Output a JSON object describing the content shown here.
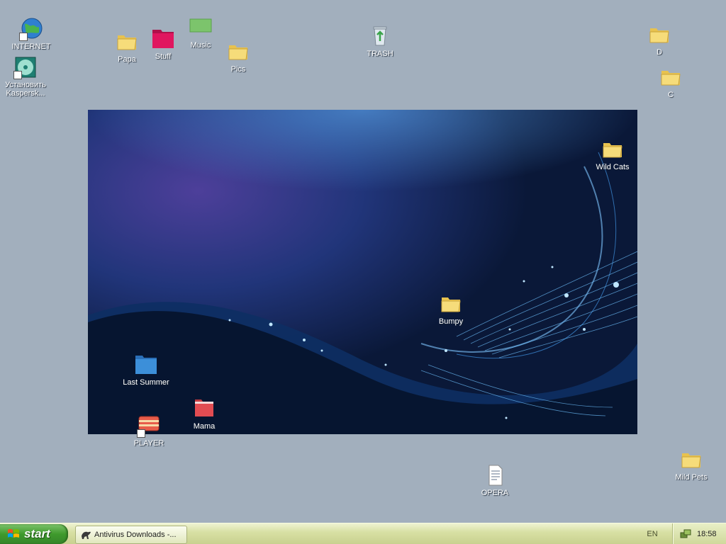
{
  "desktop": {
    "icons": [
      {
        "name": "icon-internet",
        "label": "INTERNET",
        "type": "globe",
        "shortcut": true
      },
      {
        "name": "icon-install-kaspersky",
        "label": "Установить Kaspersk...",
        "type": "cd",
        "shortcut": true
      },
      {
        "name": "icon-papa",
        "label": "Papa",
        "type": "folder"
      },
      {
        "name": "icon-stuff",
        "label": "Stuff",
        "type": "folder-pink"
      },
      {
        "name": "icon-music",
        "label": "Music",
        "type": "folder-green"
      },
      {
        "name": "icon-pics",
        "label": "Pics",
        "type": "folder"
      },
      {
        "name": "icon-trash",
        "label": "TRASH",
        "type": "recycle-bin"
      },
      {
        "name": "icon-d",
        "label": "D",
        "type": "folder"
      },
      {
        "name": "icon-c",
        "label": "C",
        "type": "folder"
      },
      {
        "name": "icon-wild-cats",
        "label": "Wild Cats",
        "type": "folder"
      },
      {
        "name": "icon-bumpy",
        "label": "Bumpy",
        "type": "folder"
      },
      {
        "name": "icon-last-summer",
        "label": "Last Summer",
        "type": "folder-blue"
      },
      {
        "name": "icon-mama",
        "label": "Mama",
        "type": "folder-red"
      },
      {
        "name": "icon-player",
        "label": "PLAYER",
        "type": "player",
        "shortcut": true
      },
      {
        "name": "icon-opera",
        "label": "OPERA",
        "type": "document"
      },
      {
        "name": "icon-mild-pets",
        "label": "Mild Pets",
        "type": "folder"
      }
    ]
  },
  "taskbar": {
    "start_label": "start",
    "task_label": "Antivirus Downloads -...",
    "language": "EN",
    "clock": "18:58"
  },
  "colors": {
    "desktop_bg": "#a2afbd",
    "folder_yellow": "#f3d76a",
    "folder_pink": "#e0165f",
    "folder_green": "#7cc46c",
    "folder_blue": "#3c8fd9",
    "folder_red": "#e24c52"
  }
}
